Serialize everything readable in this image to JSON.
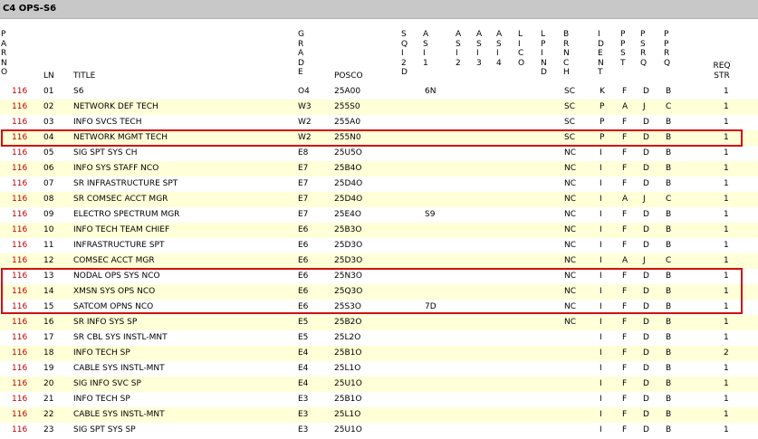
{
  "title": "C4 OPS-S6",
  "headers": {
    "paro": [
      "P",
      "A",
      "R",
      "N",
      "O"
    ],
    "ln": "LN",
    "title": "TITLE",
    "grade": [
      "G",
      "R",
      "A",
      "D",
      "E"
    ],
    "posco": "POSCO",
    "sqi2d": [
      "S",
      "Q",
      "I",
      "2",
      "D"
    ],
    "asi1": [
      "A",
      "S",
      "I",
      "1"
    ],
    "asi2": [
      "A",
      "S",
      "I",
      "2"
    ],
    "asi3": [
      "A",
      "S",
      "I",
      "3"
    ],
    "asi4": [
      "A",
      "S",
      "I",
      "4"
    ],
    "lico": [
      "L",
      "I",
      "C",
      "O"
    ],
    "lpind": [
      "L",
      "P",
      "I",
      "N",
      "D"
    ],
    "brnch": [
      "B",
      "R",
      "N",
      "C",
      "H"
    ],
    "ident": [
      "I",
      "D",
      "E",
      "N",
      "T"
    ],
    "ppst": [
      "P",
      "P",
      "S",
      "T"
    ],
    "psrq": [
      "P",
      "S",
      "R",
      "Q"
    ],
    "pprq": [
      "P",
      "P",
      "R",
      "Q"
    ],
    "reqstr": [
      "REQ",
      "STR"
    ]
  },
  "rows": [
    {
      "paro": "116",
      "ln": "01",
      "title": "S6",
      "grade": "O4",
      "posco": "25A00",
      "asi1": "6N",
      "brnch": "SC",
      "ident": "K",
      "ppst": "F",
      "psrq": "D",
      "pprq": "B",
      "req": "1"
    },
    {
      "paro": "116",
      "ln": "02",
      "title": "NETWORK DEF TECH",
      "grade": "W3",
      "posco": "255S0",
      "asi1": "",
      "brnch": "SC",
      "ident": "P",
      "ppst": "A",
      "psrq": "J",
      "pprq": "C",
      "req": "1"
    },
    {
      "paro": "116",
      "ln": "03",
      "title": "INFO SVCS TECH",
      "grade": "W2",
      "posco": "255A0",
      "asi1": "",
      "brnch": "SC",
      "ident": "P",
      "ppst": "F",
      "psrq": "D",
      "pprq": "B",
      "req": "1"
    },
    {
      "paro": "116",
      "ln": "04",
      "title": "NETWORK MGMT TECH",
      "grade": "W2",
      "posco": "255N0",
      "asi1": "",
      "brnch": "SC",
      "ident": "P",
      "ppst": "F",
      "psrq": "D",
      "pprq": "B",
      "req": "1"
    },
    {
      "paro": "116",
      "ln": "05",
      "title": "SIG SPT SYS CH",
      "grade": "E8",
      "posco": "25U5O",
      "asi1": "",
      "brnch": "NC",
      "ident": "I",
      "ppst": "F",
      "psrq": "D",
      "pprq": "B",
      "req": "1"
    },
    {
      "paro": "116",
      "ln": "06",
      "title": "INFO SYS STAFF NCO",
      "grade": "E7",
      "posco": "25B4O",
      "asi1": "",
      "brnch": "NC",
      "ident": "I",
      "ppst": "F",
      "psrq": "D",
      "pprq": "B",
      "req": "1"
    },
    {
      "paro": "116",
      "ln": "07",
      "title": "SR INFRASTRUCTURE SPT",
      "grade": "E7",
      "posco": "25D4O",
      "asi1": "",
      "brnch": "NC",
      "ident": "I",
      "ppst": "F",
      "psrq": "D",
      "pprq": "B",
      "req": "1"
    },
    {
      "paro": "116",
      "ln": "08",
      "title": "SR COMSEC ACCT MGR",
      "grade": "E7",
      "posco": "25D4O",
      "asi1": "",
      "brnch": "NC",
      "ident": "I",
      "ppst": "A",
      "psrq": "J",
      "pprq": "C",
      "req": "1"
    },
    {
      "paro": "116",
      "ln": "09",
      "title": "ELECTRO SPECTRUM MGR",
      "grade": "E7",
      "posco": "25E4O",
      "asi1": "S9",
      "brnch": "NC",
      "ident": "I",
      "ppst": "F",
      "psrq": "D",
      "pprq": "B",
      "req": "1"
    },
    {
      "paro": "116",
      "ln": "10",
      "title": "INFO TECH TEAM CHIEF",
      "grade": "E6",
      "posco": "25B3O",
      "asi1": "",
      "brnch": "NC",
      "ident": "I",
      "ppst": "F",
      "psrq": "D",
      "pprq": "B",
      "req": "1"
    },
    {
      "paro": "116",
      "ln": "11",
      "title": "INFRASTRUCTURE SPT",
      "grade": "E6",
      "posco": "25D3O",
      "asi1": "",
      "brnch": "NC",
      "ident": "I",
      "ppst": "F",
      "psrq": "D",
      "pprq": "B",
      "req": "1"
    },
    {
      "paro": "116",
      "ln": "12",
      "title": "COMSEC ACCT MGR",
      "grade": "E6",
      "posco": "25D3O",
      "asi1": "",
      "brnch": "NC",
      "ident": "I",
      "ppst": "A",
      "psrq": "J",
      "pprq": "C",
      "req": "1"
    },
    {
      "paro": "116",
      "ln": "13",
      "title": "NODAL OPS SYS NCO",
      "grade": "E6",
      "posco": "25N3O",
      "asi1": "",
      "brnch": "NC",
      "ident": "I",
      "ppst": "F",
      "psrq": "D",
      "pprq": "B",
      "req": "1"
    },
    {
      "paro": "116",
      "ln": "14",
      "title": "XMSN SYS OPS NCO",
      "grade": "E6",
      "posco": "25Q3O",
      "asi1": "",
      "brnch": "NC",
      "ident": "I",
      "ppst": "F",
      "psrq": "D",
      "pprq": "B",
      "req": "1"
    },
    {
      "paro": "116",
      "ln": "15",
      "title": "SATCOM OPNS NCO",
      "grade": "E6",
      "posco": "25S3O",
      "asi1": "7D",
      "brnch": "NC",
      "ident": "I",
      "ppst": "F",
      "psrq": "D",
      "pprq": "B",
      "req": "1"
    },
    {
      "paro": "116",
      "ln": "16",
      "title": "SR INFO SYS SP",
      "grade": "E5",
      "posco": "25B2O",
      "asi1": "",
      "brnch": "NC",
      "ident": "I",
      "ppst": "F",
      "psrq": "D",
      "pprq": "B",
      "req": "1"
    },
    {
      "paro": "116",
      "ln": "17",
      "title": "SR CBL SYS INSTL-MNT",
      "grade": "E5",
      "posco": "25L2O",
      "asi1": "",
      "brnch": "",
      "ident": "I",
      "ppst": "F",
      "psrq": "D",
      "pprq": "B",
      "req": "1"
    },
    {
      "paro": "116",
      "ln": "18",
      "title": "INFO TECH SP",
      "grade": "E4",
      "posco": "25B1O",
      "asi1": "",
      "brnch": "",
      "ident": "I",
      "ppst": "F",
      "psrq": "D",
      "pprq": "B",
      "req": "2"
    },
    {
      "paro": "116",
      "ln": "19",
      "title": "CABLE SYS INSTL-MNT",
      "grade": "E4",
      "posco": "25L1O",
      "asi1": "",
      "brnch": "",
      "ident": "I",
      "ppst": "F",
      "psrq": "D",
      "pprq": "B",
      "req": "1"
    },
    {
      "paro": "116",
      "ln": "20",
      "title": "SIG INFO SVC SP",
      "grade": "E4",
      "posco": "25U1O",
      "asi1": "",
      "brnch": "",
      "ident": "I",
      "ppst": "F",
      "psrq": "D",
      "pprq": "B",
      "req": "1"
    },
    {
      "paro": "116",
      "ln": "21",
      "title": "INFO TECH SP",
      "grade": "E3",
      "posco": "25B1O",
      "asi1": "",
      "brnch": "",
      "ident": "I",
      "ppst": "F",
      "psrq": "D",
      "pprq": "B",
      "req": "1"
    },
    {
      "paro": "116",
      "ln": "22",
      "title": "CABLE SYS INSTL-MNT",
      "grade": "E3",
      "posco": "25L1O",
      "asi1": "",
      "brnch": "",
      "ident": "I",
      "ppst": "F",
      "psrq": "D",
      "pprq": "B",
      "req": "1"
    },
    {
      "paro": "116",
      "ln": "23",
      "title": "SIG SPT SYS SP",
      "grade": "E3",
      "posco": "25U1O",
      "asi1": "",
      "brnch": "",
      "ident": "I",
      "ppst": "F",
      "psrq": "D",
      "pprq": "B",
      "req": "1"
    }
  ],
  "highlight_color": "#d01010",
  "paro_color": "#c00000",
  "alt_row_color": "#ffffd8"
}
